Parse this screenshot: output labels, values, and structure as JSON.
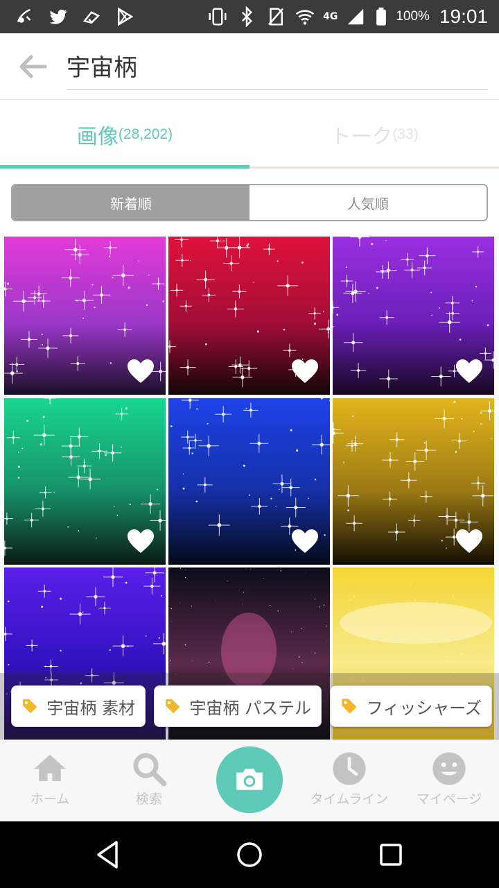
{
  "status_bar": {
    "network": "4G",
    "battery": "100%",
    "time": "19:01",
    "icons": [
      "wifi-calling-icon",
      "twitter-icon",
      "media-icon",
      "play-store-icon",
      "vibrate-icon",
      "bluetooth-icon",
      "no-sim-icon",
      "wifi-icon",
      "signal-icon",
      "battery-icon"
    ]
  },
  "header": {
    "search_value": "宇宙柄",
    "back_icon": "arrow-left-icon"
  },
  "tabs": [
    {
      "label": "画像",
      "count": "(28,202)",
      "active": true
    },
    {
      "label": "トーク",
      "count": "(33)",
      "active": false
    }
  ],
  "sort": {
    "options": [
      "新着順",
      "人気順"
    ],
    "selected": "新着順"
  },
  "grid": {
    "tiles": [
      {
        "theme": "magenta-purple sparkle",
        "colors": [
          "#e23ad8",
          "#9b37c9",
          "#1a0f28"
        ],
        "liked": true
      },
      {
        "theme": "red sparkle",
        "colors": [
          "#e0123c",
          "#a10d36",
          "#120608"
        ],
        "liked": true
      },
      {
        "theme": "violet sparkle",
        "colors": [
          "#9a2fe0",
          "#6a1fb8",
          "#150820"
        ],
        "liked": true
      },
      {
        "theme": "green sparkle",
        "colors": [
          "#18d690",
          "#17926a",
          "#0b1a14"
        ],
        "liked": true
      },
      {
        "theme": "blue sparkle",
        "colors": [
          "#1e42e8",
          "#1530a8",
          "#050a18"
        ],
        "liked": true
      },
      {
        "theme": "gold sparkle",
        "colors": [
          "#e2b51c",
          "#9c7a14",
          "#120e04"
        ],
        "liked": true
      },
      {
        "theme": "indigo sparkle",
        "colors": [
          "#5a1fe8",
          "#3212c0",
          "#1a0a40"
        ],
        "liked": false
      },
      {
        "theme": "space nebula",
        "colors": [
          "#0c0c1a",
          "#5a2a4a",
          "#04040c"
        ],
        "liked": false
      },
      {
        "theme": "yellow pastel sky",
        "colors": [
          "#f3d536",
          "#f7ea8a",
          "#f0c020"
        ],
        "liked": false
      }
    ]
  },
  "tags": [
    "宇宙柄 素材",
    "宇宙柄 パステル",
    "フィッシャーズ"
  ],
  "bottom_nav": [
    {
      "label": "ホーム",
      "icon": "home-icon"
    },
    {
      "label": "検索",
      "icon": "search-icon"
    },
    {
      "label": "",
      "icon": "camera-icon"
    },
    {
      "label": "タイムライン",
      "icon": "clock-icon"
    },
    {
      "label": "マイページ",
      "icon": "smiley-icon"
    }
  ],
  "colors": {
    "accent": "#5fcab8",
    "status_bar": "#3b3b3b",
    "nav_inactive": "#c4c4c4",
    "tag_icon": "#f2b827"
  }
}
